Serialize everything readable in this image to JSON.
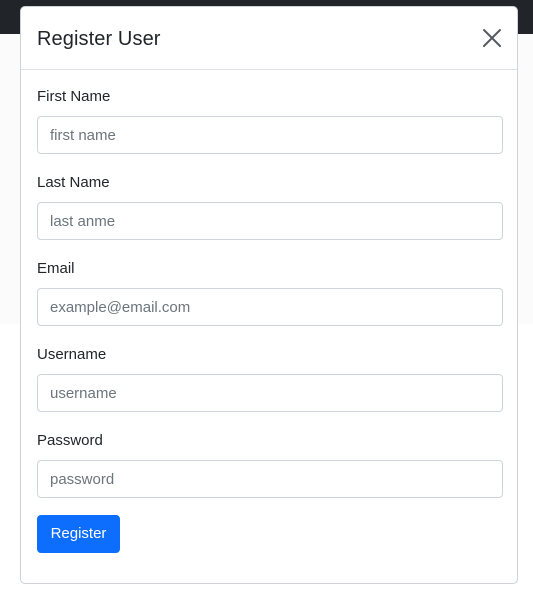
{
  "modal": {
    "title": "Register User",
    "close_icon": "close-icon"
  },
  "form": {
    "fields": [
      {
        "label": "First Name",
        "placeholder": "first name",
        "value": ""
      },
      {
        "label": "Last Name",
        "placeholder": "last anme",
        "value": ""
      },
      {
        "label": "Email",
        "placeholder": "example@email.com",
        "value": ""
      },
      {
        "label": "Username",
        "placeholder": "username",
        "value": ""
      },
      {
        "label": "Password",
        "placeholder": "password",
        "value": ""
      }
    ],
    "submit_label": "Register"
  },
  "colors": {
    "primary": "#0d6efd",
    "navbar": "#212529",
    "border": "#ced4da"
  }
}
